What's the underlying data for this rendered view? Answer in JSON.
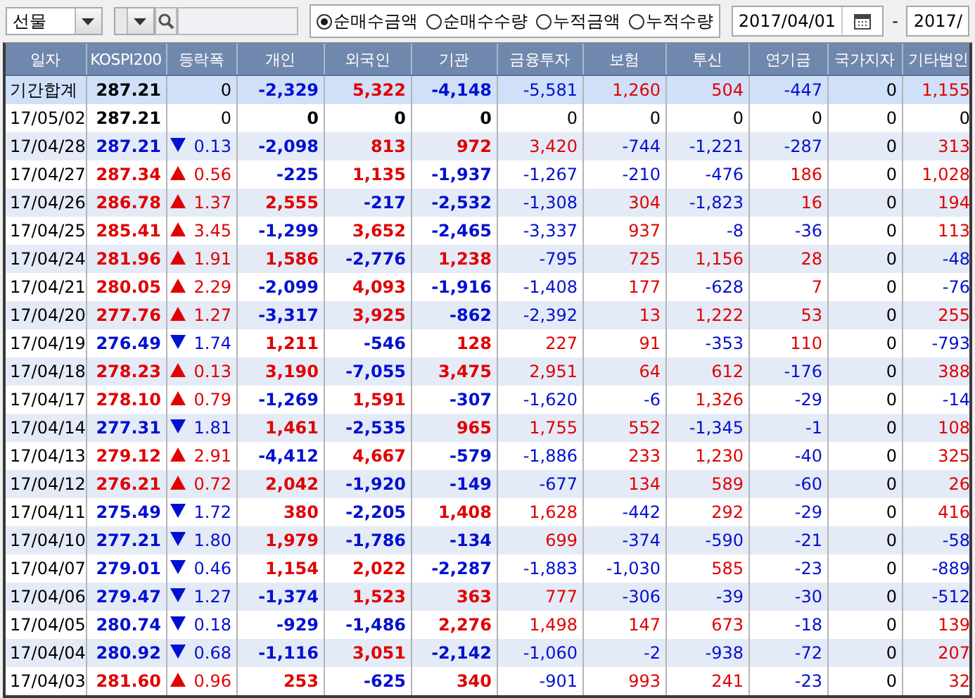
{
  "toolbar": {
    "market_select": {
      "value": "선물"
    },
    "view_options": [
      {
        "label": "순매수금액",
        "selected": true
      },
      {
        "label": "순매수수량",
        "selected": false
      },
      {
        "label": "누적금액",
        "selected": false
      },
      {
        "label": "누적수량",
        "selected": false
      }
    ],
    "date_from": "2017/04/01",
    "date_separator": "-",
    "date_to": "2017/"
  },
  "table": {
    "columns": [
      "일자",
      "KOSPI200",
      "등락폭",
      "개인",
      "외국인",
      "기관",
      "금융투자",
      "보험",
      "투신",
      "연기금",
      "국가지자",
      "기타법인"
    ],
    "rows": [
      {
        "kind": "summary",
        "date": "기간합계",
        "kospi": "287.21",
        "change": {
          "kind": "flat",
          "text": "0"
        },
        "values": [
          "-2,329",
          "5,322",
          "-4,148",
          "-5,581",
          "1,260",
          "504",
          "-447",
          "0",
          "1,155"
        ]
      },
      {
        "kind": "day",
        "date": "17/05/02",
        "kospi": "287.21",
        "change": {
          "kind": "flat",
          "text": "0"
        },
        "values": [
          "0",
          "0",
          "0",
          "0",
          "0",
          "0",
          "0",
          "0",
          "0"
        ]
      },
      {
        "kind": "day",
        "date": "17/04/28",
        "kospi": "287.21",
        "change": {
          "kind": "down",
          "text": "0.13"
        },
        "values": [
          "-2,098",
          "813",
          "972",
          "3,420",
          "-744",
          "-1,221",
          "-287",
          "0",
          "313"
        ]
      },
      {
        "kind": "day",
        "date": "17/04/27",
        "kospi": "287.34",
        "change": {
          "kind": "up",
          "text": "0.56"
        },
        "values": [
          "-225",
          "1,135",
          "-1,937",
          "-1,267",
          "-210",
          "-476",
          "186",
          "0",
          "1,028"
        ]
      },
      {
        "kind": "day",
        "date": "17/04/26",
        "kospi": "286.78",
        "change": {
          "kind": "up",
          "text": "1.37"
        },
        "values": [
          "2,555",
          "-217",
          "-2,532",
          "-1,308",
          "304",
          "-1,823",
          "16",
          "0",
          "194"
        ]
      },
      {
        "kind": "day",
        "date": "17/04/25",
        "kospi": "285.41",
        "change": {
          "kind": "up",
          "text": "3.45"
        },
        "values": [
          "-1,299",
          "3,652",
          "-2,465",
          "-3,337",
          "937",
          "-8",
          "-36",
          "0",
          "113"
        ]
      },
      {
        "kind": "day",
        "date": "17/04/24",
        "kospi": "281.96",
        "change": {
          "kind": "up",
          "text": "1.91"
        },
        "values": [
          "1,586",
          "-2,776",
          "1,238",
          "-795",
          "725",
          "1,156",
          "28",
          "0",
          "-48"
        ]
      },
      {
        "kind": "day",
        "date": "17/04/21",
        "kospi": "280.05",
        "change": {
          "kind": "up",
          "text": "2.29"
        },
        "values": [
          "-2,099",
          "4,093",
          "-1,916",
          "-1,408",
          "177",
          "-628",
          "7",
          "0",
          "-76"
        ]
      },
      {
        "kind": "day",
        "date": "17/04/20",
        "kospi": "277.76",
        "change": {
          "kind": "up",
          "text": "1.27"
        },
        "values": [
          "-3,317",
          "3,925",
          "-862",
          "-2,392",
          "13",
          "1,222",
          "53",
          "0",
          "255"
        ]
      },
      {
        "kind": "day",
        "date": "17/04/19",
        "kospi": "276.49",
        "change": {
          "kind": "down",
          "text": "1.74"
        },
        "values": [
          "1,211",
          "-546",
          "128",
          "227",
          "91",
          "-353",
          "110",
          "0",
          "-793"
        ]
      },
      {
        "kind": "day",
        "date": "17/04/18",
        "kospi": "278.23",
        "change": {
          "kind": "up",
          "text": "0.13"
        },
        "values": [
          "3,190",
          "-7,055",
          "3,475",
          "2,951",
          "64",
          "612",
          "-176",
          "0",
          "388"
        ]
      },
      {
        "kind": "day",
        "date": "17/04/17",
        "kospi": "278.10",
        "change": {
          "kind": "up",
          "text": "0.79"
        },
        "values": [
          "-1,269",
          "1,591",
          "-307",
          "-1,620",
          "-6",
          "1,326",
          "-29",
          "0",
          "-14"
        ]
      },
      {
        "kind": "day",
        "date": "17/04/14",
        "kospi": "277.31",
        "change": {
          "kind": "down",
          "text": "1.81"
        },
        "values": [
          "1,461",
          "-2,535",
          "965",
          "1,755",
          "552",
          "-1,345",
          "-1",
          "0",
          "108"
        ]
      },
      {
        "kind": "day",
        "date": "17/04/13",
        "kospi": "279.12",
        "change": {
          "kind": "up",
          "text": "2.91"
        },
        "values": [
          "-4,412",
          "4,667",
          "-579",
          "-1,886",
          "233",
          "1,230",
          "-40",
          "0",
          "325"
        ]
      },
      {
        "kind": "day",
        "date": "17/04/12",
        "kospi": "276.21",
        "change": {
          "kind": "up",
          "text": "0.72"
        },
        "values": [
          "2,042",
          "-1,920",
          "-149",
          "-677",
          "134",
          "589",
          "-60",
          "0",
          "26"
        ]
      },
      {
        "kind": "day",
        "date": "17/04/11",
        "kospi": "275.49",
        "change": {
          "kind": "down",
          "text": "1.72"
        },
        "values": [
          "380",
          "-2,205",
          "1,408",
          "1,628",
          "-442",
          "292",
          "-29",
          "0",
          "416"
        ]
      },
      {
        "kind": "day",
        "date": "17/04/10",
        "kospi": "277.21",
        "change": {
          "kind": "down",
          "text": "1.80"
        },
        "values": [
          "1,979",
          "-1,786",
          "-134",
          "699",
          "-374",
          "-590",
          "-21",
          "0",
          "-58"
        ]
      },
      {
        "kind": "day",
        "date": "17/04/07",
        "kospi": "279.01",
        "change": {
          "kind": "down",
          "text": "0.46"
        },
        "values": [
          "1,154",
          "2,022",
          "-2,287",
          "-1,883",
          "-1,030",
          "585",
          "-23",
          "0",
          "-889"
        ]
      },
      {
        "kind": "day",
        "date": "17/04/06",
        "kospi": "279.47",
        "change": {
          "kind": "down",
          "text": "1.27"
        },
        "values": [
          "-1,374",
          "1,523",
          "363",
          "777",
          "-306",
          "-39",
          "-30",
          "0",
          "-512"
        ]
      },
      {
        "kind": "day",
        "date": "17/04/05",
        "kospi": "280.74",
        "change": {
          "kind": "down",
          "text": "0.18"
        },
        "values": [
          "-929",
          "-1,486",
          "2,276",
          "1,498",
          "147",
          "673",
          "-18",
          "0",
          "139"
        ]
      },
      {
        "kind": "day",
        "date": "17/04/04",
        "kospi": "280.92",
        "change": {
          "kind": "down",
          "text": "0.68"
        },
        "values": [
          "-1,116",
          "3,051",
          "-2,142",
          "-1,060",
          "-2",
          "-938",
          "-72",
          "0",
          "207"
        ]
      },
      {
        "kind": "day",
        "date": "17/04/03",
        "kospi": "281.60",
        "change": {
          "kind": "up",
          "text": "0.96"
        },
        "values": [
          "253",
          "-625",
          "340",
          "-901",
          "993",
          "241",
          "-23",
          "0",
          "32"
        ]
      }
    ]
  }
}
